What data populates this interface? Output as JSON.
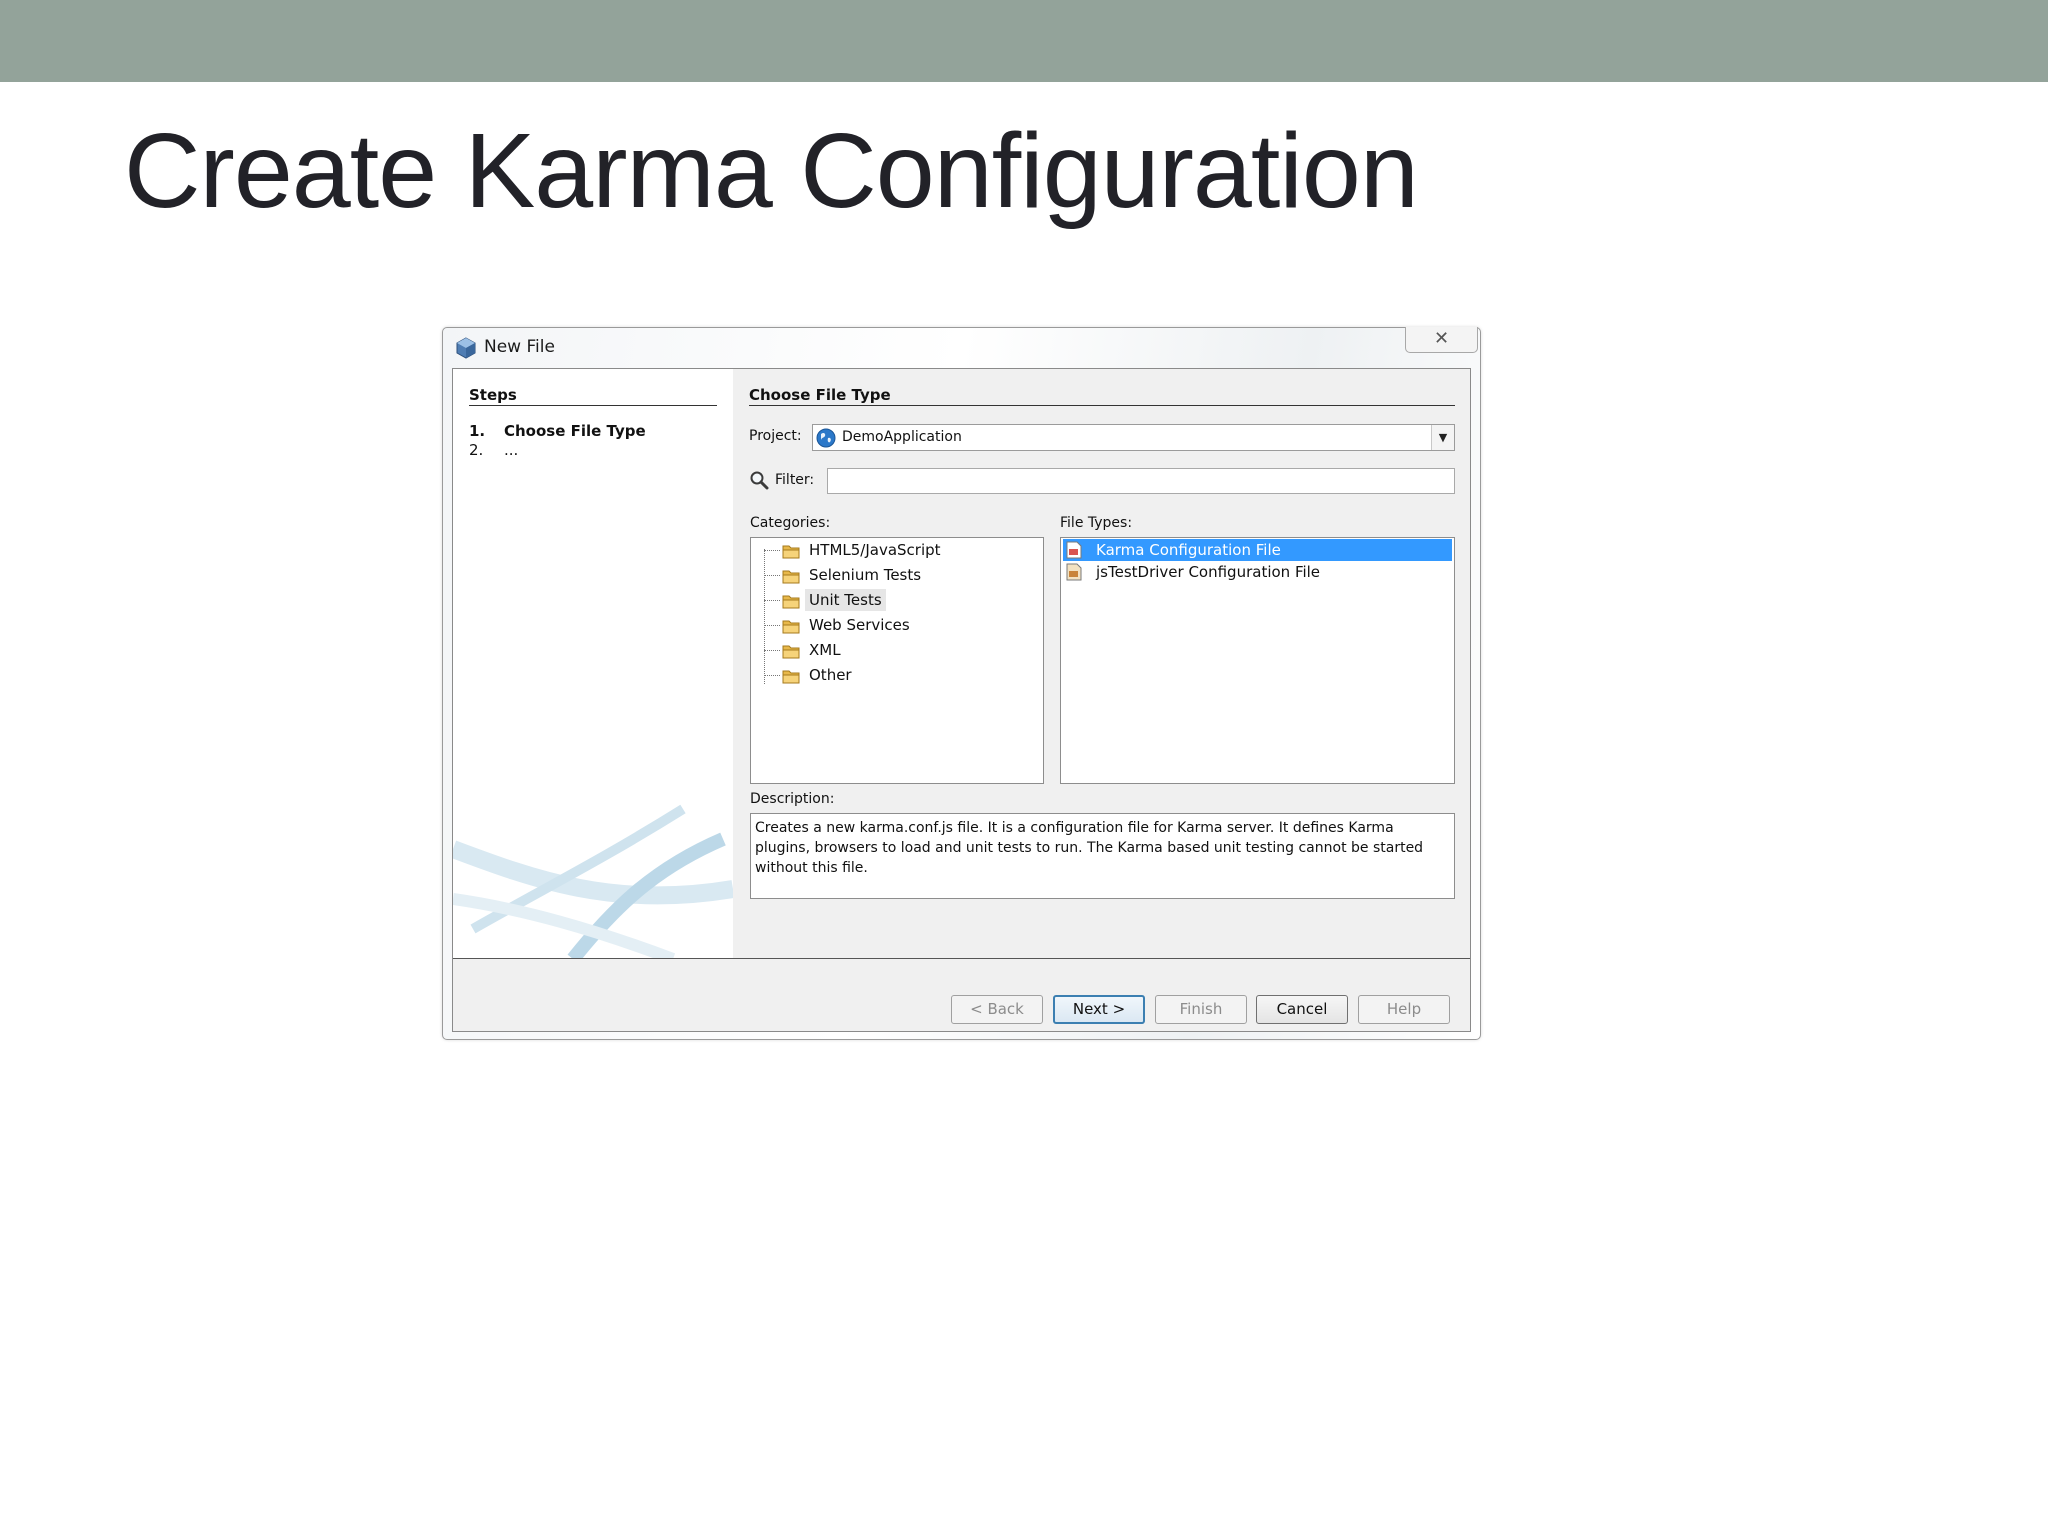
{
  "slide": {
    "title": "Create Karma Configuration"
  },
  "dialog": {
    "title": "New File",
    "close_glyph": "✕",
    "steps": {
      "heading": "Steps",
      "items": [
        {
          "num": "1.",
          "label": "Choose File Type"
        },
        {
          "num": "2.",
          "label": "..."
        }
      ]
    },
    "main": {
      "heading": "Choose File Type",
      "project_label": "Project:",
      "project_value": "DemoApplication",
      "filter_label": "Filter:",
      "filter_value": "",
      "categories_label": "Categories:",
      "categories": [
        {
          "label": "HTML5/JavaScript",
          "selected": false
        },
        {
          "label": "Selenium Tests",
          "selected": false
        },
        {
          "label": "Unit Tests",
          "selected": true
        },
        {
          "label": "Web Services",
          "selected": false
        },
        {
          "label": "XML",
          "selected": false
        },
        {
          "label": "Other",
          "selected": false
        }
      ],
      "file_types_label": "File Types:",
      "file_types": [
        {
          "label": "Karma Configuration File",
          "selected": true
        },
        {
          "label": "jsTestDriver Configuration File",
          "selected": false
        }
      ],
      "description_label": "Description:",
      "description_text": "Creates a new karma.conf.js file. It is a configuration file for Karma server. It defines Karma plugins, browsers to load and unit tests to run. The Karma based unit testing cannot be started without this file."
    },
    "buttons": {
      "back": "< Back",
      "next": "Next >",
      "finish": "Finish",
      "cancel": "Cancel",
      "help": "Help"
    }
  },
  "colors": {
    "top_bar": "#93a39a",
    "selection": "#3399ff",
    "default_button_border": "#3c7fb1"
  },
  "icons": [
    "app-cube-icon",
    "close-icon",
    "globe-icon",
    "search-icon",
    "folder-icon",
    "js-file-icon",
    "config-file-icon",
    "dropdown-arrow-icon"
  ]
}
